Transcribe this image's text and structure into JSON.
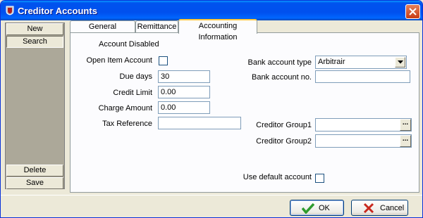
{
  "window": {
    "title": "Creditor Accounts"
  },
  "sidebar": {
    "items": [
      {
        "label": "New"
      },
      {
        "label": "Search"
      },
      {
        "label": "Delete"
      },
      {
        "label": "Save"
      }
    ]
  },
  "tabs": [
    {
      "label": "General Information"
    },
    {
      "label": "Remittance"
    },
    {
      "label": "Accounting Information",
      "active": true
    }
  ],
  "form": {
    "account_disabled_label": "Account Disabled",
    "open_item_label": "Open Item Account",
    "open_item_checked": false,
    "due_days_label": "Due days",
    "due_days_value": "30",
    "credit_limit_label": "Credit Limit",
    "credit_limit_value": "0.00",
    "charge_amount_label": "Charge Amount",
    "charge_amount_value": "0.00",
    "tax_reference_label": "Tax Reference",
    "tax_reference_value": "",
    "bank_type_label": "Bank account type",
    "bank_type_value": "Arbitrair",
    "bank_no_label": "Bank account no.",
    "bank_no_value": "",
    "group1_label": "Creditor Group1",
    "group1_value": "",
    "group2_label": "Creditor Group2",
    "group2_value": "",
    "lookup_glyph": "...",
    "use_default_label": "Use default account",
    "use_default_checked": false
  },
  "buttons": {
    "ok_label": "OK",
    "cancel_label": "Cancel"
  },
  "colors": {
    "titlebar": "#0054E3",
    "window_bg": "#ECE9D8",
    "tab_highlight": "#FFC83C",
    "ok_icon": "#2E9B2E",
    "cancel_icon": "#C8281E"
  }
}
